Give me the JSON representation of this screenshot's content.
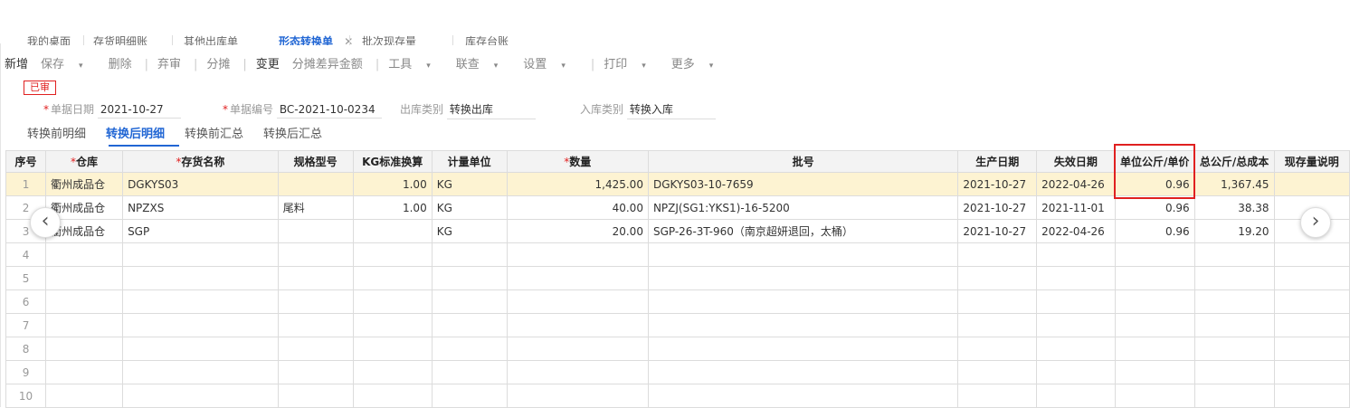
{
  "top_tabs": [
    {
      "label": "我的桌面"
    },
    {
      "label": "存货明细账"
    },
    {
      "label": "其他出库单"
    },
    {
      "label": "形态转换单",
      "active": true,
      "close": "✕"
    },
    {
      "label": "批次现存量"
    },
    {
      "label": "库存台账"
    }
  ],
  "toolbar": {
    "items": [
      {
        "label": "新增",
        "dark": true
      },
      {
        "label": "保存",
        "caret": true
      },
      {
        "label": "删除"
      },
      {
        "label": "弃审"
      },
      {
        "label": "分摊"
      },
      {
        "label": "变更",
        "dark": true
      },
      {
        "label": "分摊差异金额"
      },
      {
        "label": "工具",
        "caret": true,
        "dark": true
      },
      {
        "label": "联查",
        "caret": true,
        "dark": true
      },
      {
        "label": "设置",
        "caret": true,
        "dark": true
      },
      {
        "label": "打印",
        "caret": true,
        "dark": true
      },
      {
        "label": "更多",
        "caret": true,
        "dark": true
      }
    ]
  },
  "status_badge": "已审",
  "header_fields": {
    "date": {
      "label": "单据日期",
      "value": "2021-10-27"
    },
    "doc_no": {
      "label": "单据编号",
      "value": "BC-2021-10-0234"
    },
    "out_type": {
      "label": "出库类别",
      "value": "转换出库"
    },
    "in_type": {
      "label": "入库类别",
      "value": "转换入库"
    }
  },
  "sub_tabs": [
    {
      "label": "转换前明细"
    },
    {
      "label": "转换后明细",
      "active": true
    },
    {
      "label": "转换前汇总"
    },
    {
      "label": "转换后汇总"
    }
  ],
  "grid": {
    "columns": [
      {
        "label": "序号"
      },
      {
        "label": "仓库",
        "required": true
      },
      {
        "label": "存货名称",
        "required": true
      },
      {
        "label": "规格型号"
      },
      {
        "label": "KG标准换算"
      },
      {
        "label": "计量单位"
      },
      {
        "label": "数量",
        "required": true
      },
      {
        "label": "批号"
      },
      {
        "label": "生产日期"
      },
      {
        "label": "失效日期"
      },
      {
        "label": "单位公斤/单价"
      },
      {
        "label": "总公斤/总成本"
      },
      {
        "label": "现存量说明"
      }
    ],
    "rows": [
      {
        "idx": "1",
        "warehouse": "衢州成品仓",
        "name": "DGKYS03",
        "spec": "",
        "kg": "1.00",
        "unit": "KG",
        "qty": "1,425.00",
        "batch": "DGKYS03-10-7659",
        "mfg": "2021-10-27",
        "exp": "2022-04-26",
        "unit_price": "0.96",
        "total": "1,367.45",
        "note": "",
        "selected": true
      },
      {
        "idx": "2",
        "warehouse": "衢州成品仓",
        "name": "NPZXS",
        "spec": "尾料",
        "kg": "1.00",
        "unit": "KG",
        "qty": "40.00",
        "batch": "NPZJ(SG1:YKS1)-16-5200",
        "mfg": "2021-10-27",
        "exp": "2021-11-01",
        "unit_price": "0.96",
        "total": "38.38",
        "note": ""
      },
      {
        "idx": "3",
        "warehouse": "衢州成品仓",
        "name": "SGP",
        "spec": "",
        "kg": "",
        "unit": "KG",
        "qty": "20.00",
        "batch": "SGP-26-3T-960（南京超妍退回，太桶）",
        "mfg": "2021-10-27",
        "exp": "2022-04-26",
        "unit_price": "0.96",
        "total": "19.20",
        "note": ""
      },
      {
        "idx": "4"
      },
      {
        "idx": "5"
      },
      {
        "idx": "6"
      },
      {
        "idx": "7"
      },
      {
        "idx": "8"
      },
      {
        "idx": "9"
      },
      {
        "idx": "10"
      }
    ]
  },
  "nav": {
    "prev": "‹",
    "next": "›"
  },
  "icons": {
    "prev": "chevron-left-icon",
    "next": "chevron-right-icon",
    "caret": "caret-down-icon",
    "close": "close-icon"
  },
  "colors": {
    "accent": "#2166d4",
    "highlight": "#e02020",
    "selected_row": "#fdf3d2"
  }
}
